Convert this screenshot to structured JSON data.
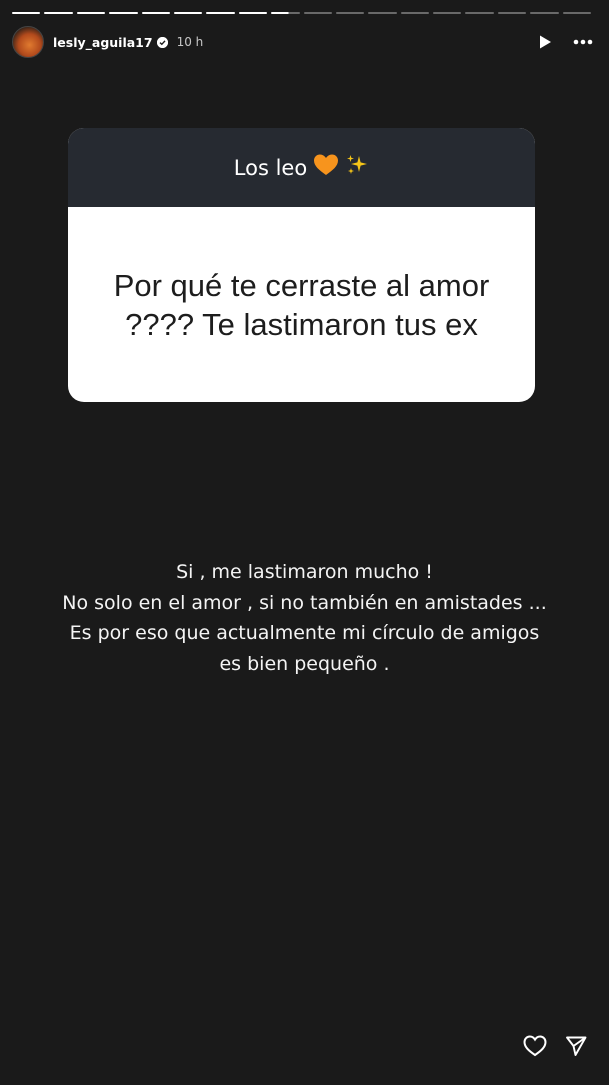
{
  "story": {
    "progress": {
      "total_segments": 18,
      "completed_segments": 8,
      "current_segment_progress": 0.6
    },
    "user": {
      "username": "lesly_aguila17",
      "verified": true,
      "time_ago": "10 h"
    }
  },
  "question_sticker": {
    "header_text": "Los leo",
    "header_emojis": [
      "orange-heart",
      "sparkles"
    ],
    "question": "Por qué te cerraste al amor ???? Te lastimaron tus ex"
  },
  "answer_lines": [
    "Si , me lastimaron mucho !",
    "No solo en el amor , si no también en amistades ...",
    "Es por eso que actualmente mi círculo de amigos",
    "es bien pequeño ."
  ],
  "colors": {
    "background": "#1a1a1a",
    "sticker_header": "#262a31",
    "heart": "#f7941d",
    "sparkles": "#f5c518"
  }
}
